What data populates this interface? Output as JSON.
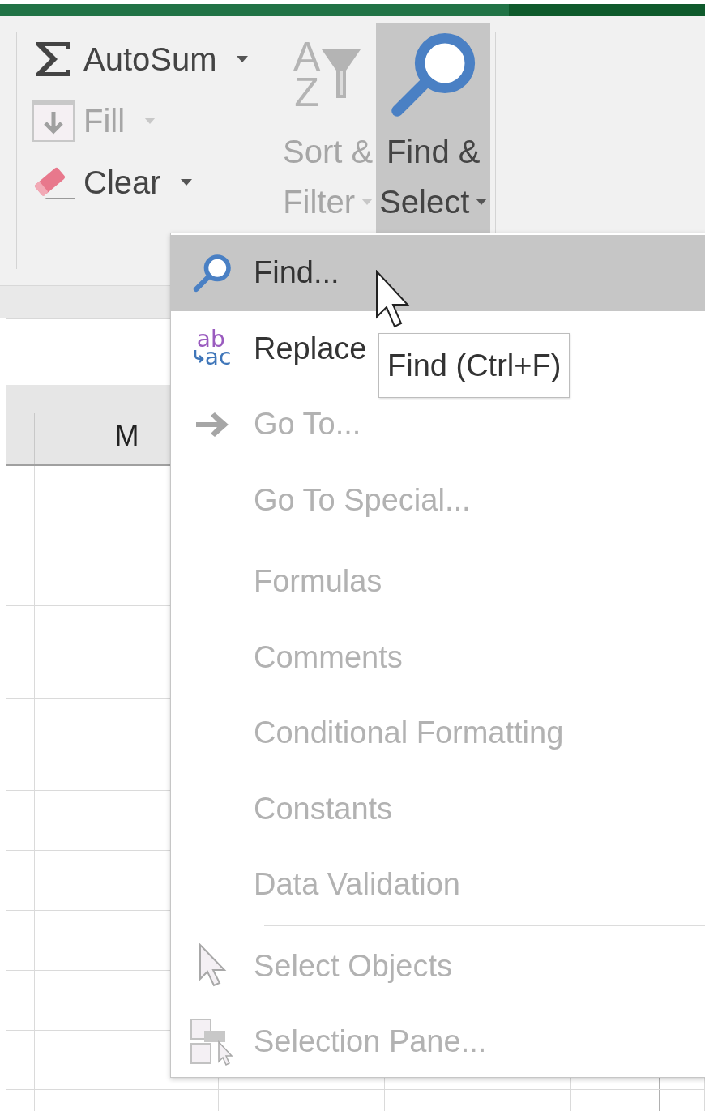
{
  "ribbon": {
    "small_buttons": [
      {
        "label": "AutoSum",
        "disabled": false
      },
      {
        "label": "Fill",
        "disabled": true
      },
      {
        "label": "Clear",
        "disabled": false
      }
    ],
    "large_buttons": [
      {
        "lines": [
          "Sort &",
          "Filter"
        ],
        "icon_letters": [
          "A",
          "Z"
        ],
        "disabled": true,
        "selected": false
      },
      {
        "lines": [
          "Find &",
          "Select"
        ],
        "disabled": false,
        "selected": true
      }
    ]
  },
  "sheet": {
    "column_headers": [
      {
        "label": "M"
      }
    ]
  },
  "menu": {
    "items": [
      {
        "kind": "item",
        "label": "Find...",
        "disabled": false,
        "selected": true
      },
      {
        "kind": "item",
        "label": "Replace",
        "icon_letters": [
          "ab",
          "ac"
        ],
        "disabled": false,
        "selected": false
      },
      {
        "kind": "item",
        "label": "Go To...",
        "disabled": true,
        "selected": false
      },
      {
        "kind": "item",
        "label": "Go To Special...",
        "disabled": true,
        "selected": false
      },
      {
        "kind": "separator"
      },
      {
        "kind": "item",
        "label": "Formulas",
        "disabled": true,
        "selected": false
      },
      {
        "kind": "item",
        "label": "Comments",
        "disabled": true,
        "selected": false
      },
      {
        "kind": "item",
        "label": "Conditional Formatting",
        "disabled": true,
        "selected": false
      },
      {
        "kind": "item",
        "label": "Constants",
        "disabled": true,
        "selected": false
      },
      {
        "kind": "item",
        "label": "Data Validation",
        "disabled": true,
        "selected": false
      },
      {
        "kind": "separator"
      },
      {
        "kind": "item",
        "label": "Select Objects",
        "disabled": true,
        "selected": false
      },
      {
        "kind": "item",
        "label": "Selection Pane...",
        "disabled": true,
        "selected": false
      }
    ]
  },
  "tooltip": {
    "text": "Find (Ctrl+F)"
  }
}
